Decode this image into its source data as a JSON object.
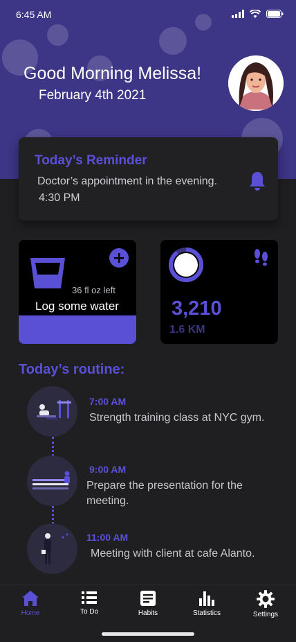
{
  "status_bar": {
    "time": "6:45 AM"
  },
  "header": {
    "greeting": "Good Morning Melissa!",
    "date": "February 4th 2021"
  },
  "reminder": {
    "title": "Today’s Reminder",
    "text": "Doctor’s appointment in the evening.",
    "time": "4:30 PM"
  },
  "water": {
    "remaining": "36 fl oz left",
    "action": "Log some water",
    "fill_fraction": 0.27
  },
  "steps": {
    "count": "3,210",
    "distance": "1.6 KM",
    "goal_progress": 0.9
  },
  "routine": {
    "title": "Today’s routine:",
    "items": [
      {
        "time": "7:00 AM",
        "text": "Strength training class at NYC gym."
      },
      {
        "time": "9:00 AM",
        "text": "Prepare the presentation for the meeting."
      },
      {
        "time": "11:00 AM",
        "text": "Meeting with client at cafe Alanto."
      }
    ]
  },
  "nav": {
    "items": [
      {
        "label": "Home",
        "icon": "home-icon",
        "active": true
      },
      {
        "label": "To Do",
        "icon": "list-icon"
      },
      {
        "label": "Habits",
        "icon": "document-icon"
      },
      {
        "label": "Statistics",
        "icon": "bar-chart-icon"
      },
      {
        "label": "Settings",
        "icon": "gear-icon"
      }
    ]
  },
  "colors": {
    "header_bg": "#3d3586",
    "accent": "#5a50d6",
    "app_bg": "#1f1f21",
    "card_bg": "#000000"
  }
}
